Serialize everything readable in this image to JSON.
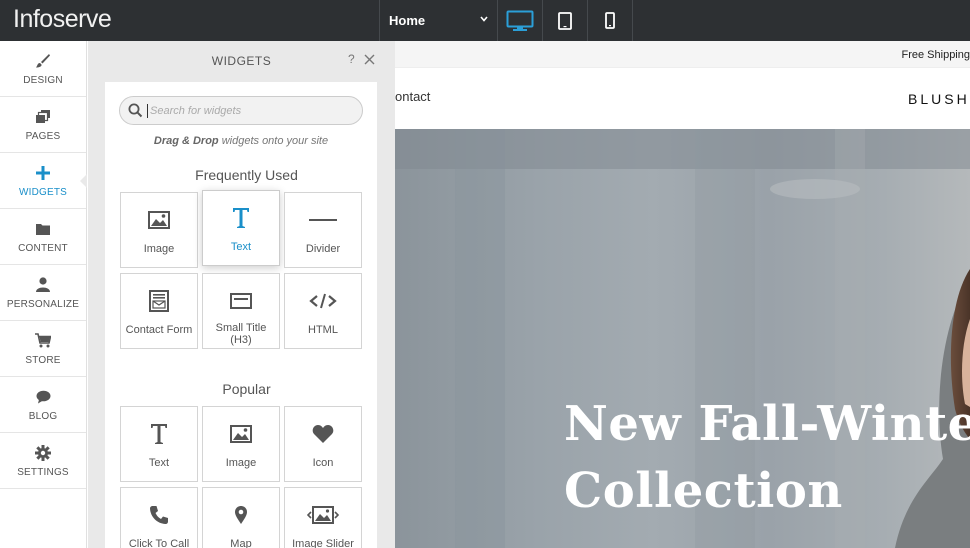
{
  "topbar": {
    "logo": "Infoserve",
    "page_select": "Home",
    "devices": [
      "desktop-icon",
      "tablet-icon",
      "mobile-icon"
    ]
  },
  "sidebar": {
    "items": [
      {
        "label": "DESIGN",
        "icon": "brush-icon"
      },
      {
        "label": "PAGES",
        "icon": "pages-icon"
      },
      {
        "label": "WIDGETS",
        "icon": "plus-icon",
        "active": true
      },
      {
        "label": "CONTENT",
        "icon": "folder-icon"
      },
      {
        "label": "PERSONALIZE",
        "icon": "user-icon"
      },
      {
        "label": "STORE",
        "icon": "cart-icon"
      },
      {
        "label": "BLOG",
        "icon": "chat-icon"
      },
      {
        "label": "SETTINGS",
        "icon": "gear-icon"
      }
    ]
  },
  "panel": {
    "title": "WIDGETS",
    "help": "?",
    "search_placeholder": "Search for widgets",
    "hint_bold": "Drag & Drop",
    "hint_rest": " widgets onto your site",
    "frequent_title": "Frequently Used",
    "frequent": [
      {
        "label": "Image",
        "icon": "image-icon"
      },
      {
        "label": "Text",
        "icon": "text-icon"
      },
      {
        "label": "Divider",
        "icon": "divider-icon"
      },
      {
        "label": "Contact Form",
        "icon": "contact-form-icon"
      },
      {
        "label": "Small Title (H3)",
        "icon": "title-icon"
      },
      {
        "label": "HTML",
        "icon": "code-icon"
      }
    ],
    "popular_title": "Popular",
    "popular": [
      {
        "label": "Text",
        "icon": "text-icon"
      },
      {
        "label": "Image",
        "icon": "image-icon"
      },
      {
        "label": "Icon",
        "icon": "heart-icon"
      },
      {
        "label": "Click To Call",
        "icon": "phone-icon"
      },
      {
        "label": "Map",
        "icon": "map-pin-icon"
      },
      {
        "label": "Image Slider",
        "icon": "image-slider-icon"
      }
    ]
  },
  "preview": {
    "promo": "Free Shipping",
    "nav_link": "ontact",
    "brand": "BLUSH",
    "hero_line1": "New Fall-Winter",
    "hero_line2": "Collection"
  },
  "colors": {
    "topbar": "#2d3033",
    "accent": "#1a8fc9",
    "panel_bg": "#e9e9e9"
  }
}
